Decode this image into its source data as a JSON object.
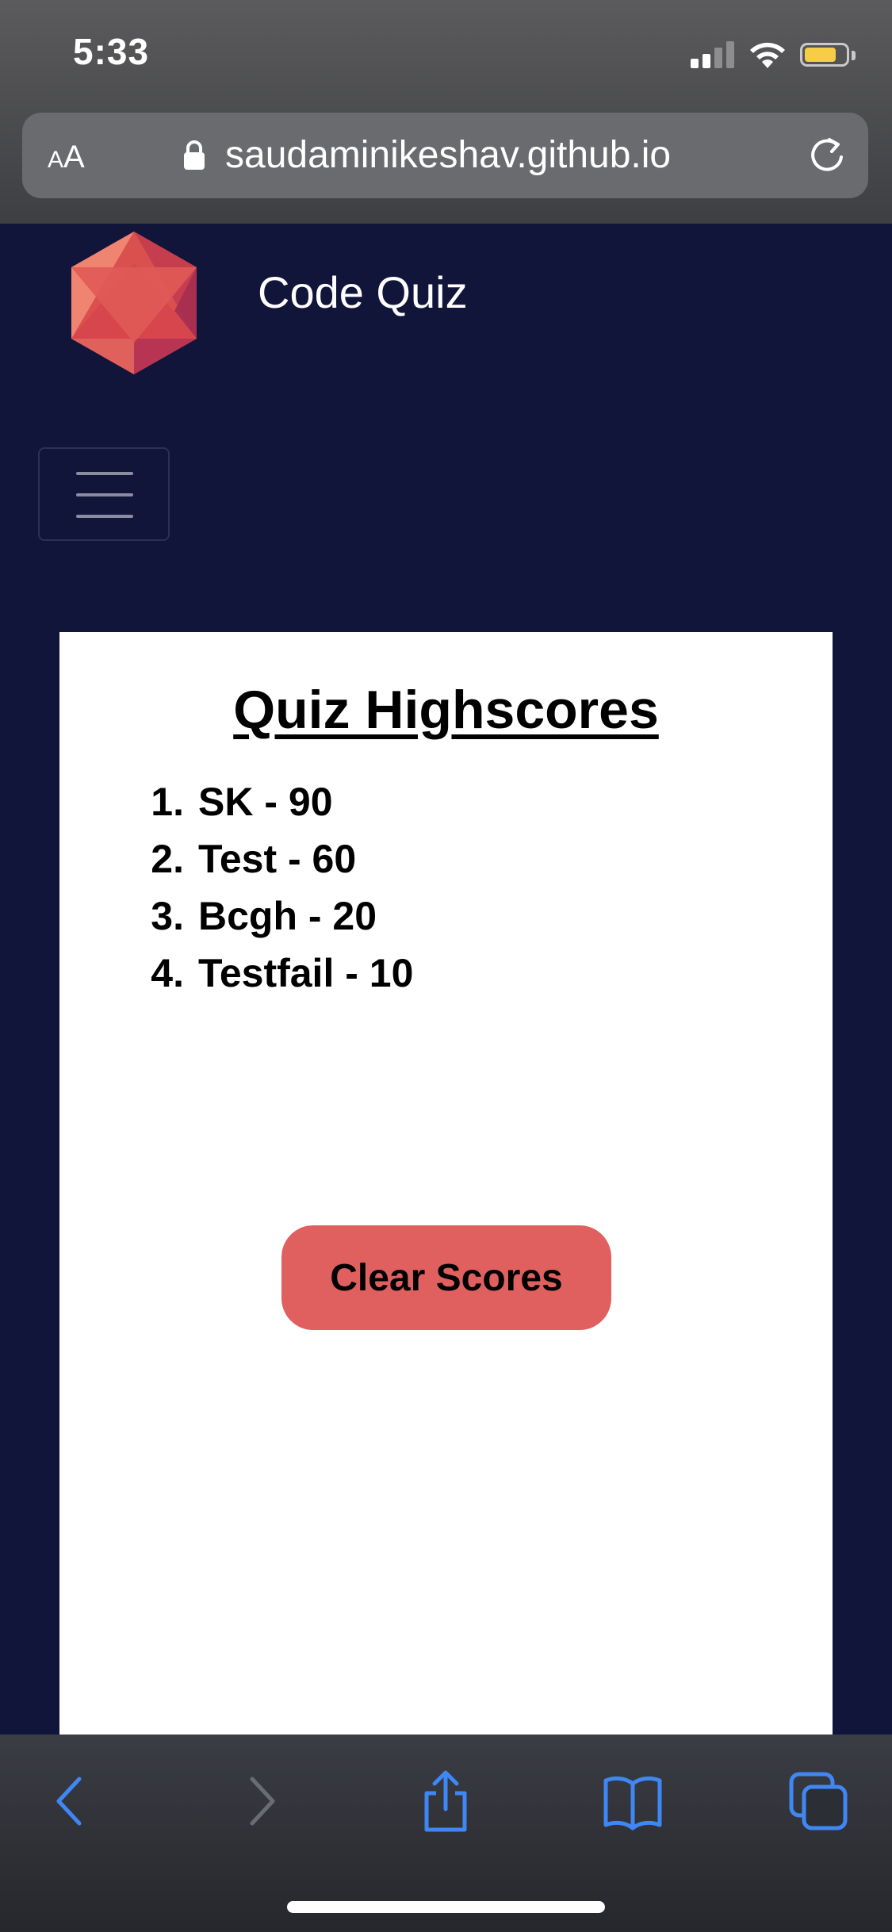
{
  "status_bar": {
    "time": "5:33"
  },
  "browser": {
    "text_size_label_small": "A",
    "text_size_label_large": "A",
    "url": "saudaminikeshav.github.io"
  },
  "site": {
    "title": "Code Quiz"
  },
  "highscores": {
    "heading": "Quiz Highscores",
    "entries": [
      {
        "rank": "1.",
        "text": "SK - 90"
      },
      {
        "rank": "2.",
        "text": "Test - 60"
      },
      {
        "rank": "3.",
        "text": "Bcgh - 20"
      },
      {
        "rank": "4.",
        "text": "Testfail - 10"
      }
    ],
    "clear_button_label": "Clear Scores"
  },
  "colors": {
    "page_background": "#12153a",
    "button_red": "#e06060",
    "toolbar_icon_blue": "#3f87f5",
    "battery_yellow": "#f5cd46"
  },
  "icons": [
    "lock-icon",
    "reload-icon",
    "signal-icon",
    "wifi-icon",
    "battery-icon",
    "back-icon",
    "forward-icon",
    "share-icon",
    "bookmarks-icon",
    "tabs-icon",
    "menu-icon",
    "logo-icon"
  ]
}
